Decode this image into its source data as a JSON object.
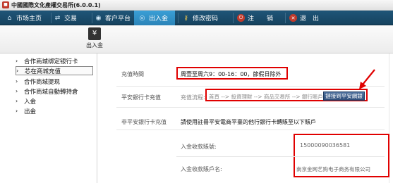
{
  "window": {
    "title": "中國國際文化產權交易所(6.0.0.1)"
  },
  "menu": {
    "items": [
      {
        "label": "市场主页",
        "icon": "home-icon"
      },
      {
        "label": "交易",
        "icon": "trade-icon"
      },
      {
        "label": "客户平台",
        "icon": "client-icon"
      },
      {
        "label": "出入金",
        "icon": "transfer-icon",
        "active": true
      },
      {
        "label": "修改密码",
        "icon": "key-icon"
      },
      {
        "label": "注　　销",
        "icon": "logout-icon"
      },
      {
        "label": "退　出",
        "icon": "exit-icon"
      }
    ]
  },
  "toolbar": {
    "button_label": "出入金",
    "icon": "money-transfer-icon"
  },
  "sidebar": {
    "items": [
      {
        "label": "合作商城绑定银行卡"
      },
      {
        "label": "芯在商城充值",
        "active": true
      },
      {
        "label": "合作商城提现"
      },
      {
        "label": "合作商城自動轉持倉"
      },
      {
        "label": "入金"
      },
      {
        "label": "出金"
      }
    ]
  },
  "main": {
    "recharge_time_label": "充值時間",
    "recharge_time_value": "周壹至周六9：00-16：00，節假日除外",
    "pingan_card_label": "平安銀行卡充值",
    "flow_label": "充值流程:",
    "flow_steps": "首頁 --> 投資理財 --> 商品交易所 --> 銀行賬戶轉交易賬戶",
    "bank_button": "鏈接到平安網銀",
    "non_pingan_label": "非平安銀行卡充值",
    "non_pingan_note": "請使用註冊平安電商平臺的他行銀行卡轉賬至以下賬戶",
    "account_number_label": "入金收款賬號:",
    "account_number_value": "15000090036581",
    "account_name_label": "入金收款賬戶名:",
    "account_name_value": "南京金网艺购电子商务有限公司"
  },
  "colors": {
    "menu_bg": "#1f5578",
    "menu_active": "#2b84b8",
    "highlight": "#e00000",
    "button": "#2f4e7a"
  }
}
